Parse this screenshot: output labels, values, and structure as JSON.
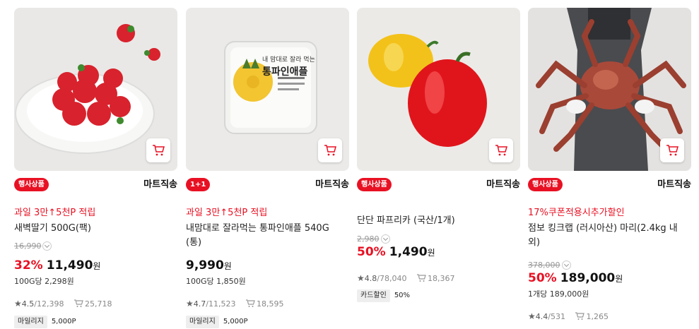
{
  "products": [
    {
      "badge": "행사상품",
      "seller": "마트직송",
      "promo": "과일 3만↑5천P 적립",
      "name": "새벽딸기 500G(팩)",
      "original_price": "16,990",
      "discount": "32%",
      "price": "11,490",
      "won": "원",
      "unit_price": "100G당 2,298원",
      "rating": "4.5",
      "reviews": "/12,398",
      "cart_count": "25,718",
      "chip_label": "마일리지",
      "chip_value": "5,000P"
    },
    {
      "badge": "1+1",
      "seller": "마트직송",
      "promo": "과일 3만↑5천P 적립",
      "name": "내맘대로 잘라먹는 통파인애플 540G (통)",
      "price": "9,990",
      "won": "원",
      "unit_price": "100G당 1,850원",
      "rating": "4.7",
      "reviews": "/11,523",
      "cart_count": "18,595",
      "chip_label": "마일리지",
      "chip_value": "5,000P",
      "package_line1": "내 맘대로 잘라 먹는",
      "package_line2": "통파인애플"
    },
    {
      "badge": "행사상품",
      "seller": "마트직송",
      "name": "단단 파프리카 (국산/1개)",
      "original_price": "2,980",
      "discount": "50%",
      "price": "1,490",
      "won": "원",
      "rating": "4.8",
      "reviews": "/78,040",
      "cart_count": "18,367",
      "chip_label": "카드할인",
      "chip_value": "50%"
    },
    {
      "badge": "행사상품",
      "seller": "마트직송",
      "promo": "17%쿠폰적용시추가할인",
      "name": "점보 킹크랩 (러시아산) 마리(2.4kg 내외)",
      "original_price": "378,000",
      "discount": "50%",
      "price": "189,000",
      "won": "원",
      "unit_price": "1개당 189,000원",
      "rating": "4.4",
      "reviews": "/531",
      "cart_count": "1,265"
    }
  ],
  "icons": {
    "star": "★",
    "cart_button": "cart-icon"
  },
  "colors": {
    "accent": "#e81123",
    "chip_bg": "#eeeeee",
    "strike": "#999999"
  }
}
